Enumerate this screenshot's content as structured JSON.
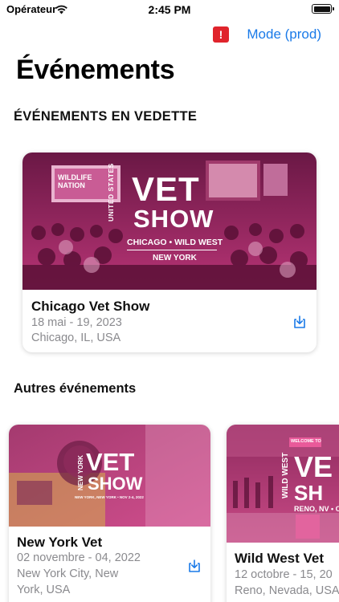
{
  "status_bar": {
    "carrier": "Opérateur",
    "time": "2:45 PM"
  },
  "header": {
    "alert_icon_glyph": "!",
    "mode_label": "Mode (prod)"
  },
  "page": {
    "title": "Événements"
  },
  "featured": {
    "section_title": "ÉVÉNEMENTS EN VEDETTE",
    "event": {
      "title": "Chicago Vet Show",
      "dates": "18 mai - 19, 2023",
      "location": "Chicago, IL, USA",
      "image_brand": {
        "side": "UNITED STATES",
        "line1": "VET",
        "line2": "SHOW",
        "cities": "CHICAGO • WILD WEST",
        "city2": "NEW YORK",
        "screen": "WILDLIFE NATION"
      }
    }
  },
  "others": {
    "section_title": "Autres événements",
    "events": [
      {
        "title": "New York Vet",
        "dates": "02 novembre - 04, 2022",
        "location_line1": "New York City, New",
        "location_line2": "York, USA",
        "image_brand": {
          "side": "NEW YORK",
          "line1": "VET",
          "line2": "SHOW",
          "sub": "NEW YORK, NEW YORK • NOV 2-4, 2022"
        }
      },
      {
        "title": "Wild West Vet",
        "dates": "12 octobre - 15, 20",
        "location_line1": "Reno, Nevada, USA",
        "image_brand": {
          "side": "WILD WEST",
          "line1": "VE",
          "line2": "SH",
          "sub": "RENO, NV • OCT",
          "banner": "WELCOME TO"
        }
      }
    ]
  },
  "icons": {
    "wifi": "wifi-icon",
    "battery": "battery-icon",
    "alert": "alert-icon",
    "download": "download-icon"
  },
  "colors": {
    "accent": "#1a7ae8",
    "alert": "#e0242c",
    "overlay_magenta": "#c2367a",
    "secondary_text": "#8a8a8e"
  }
}
